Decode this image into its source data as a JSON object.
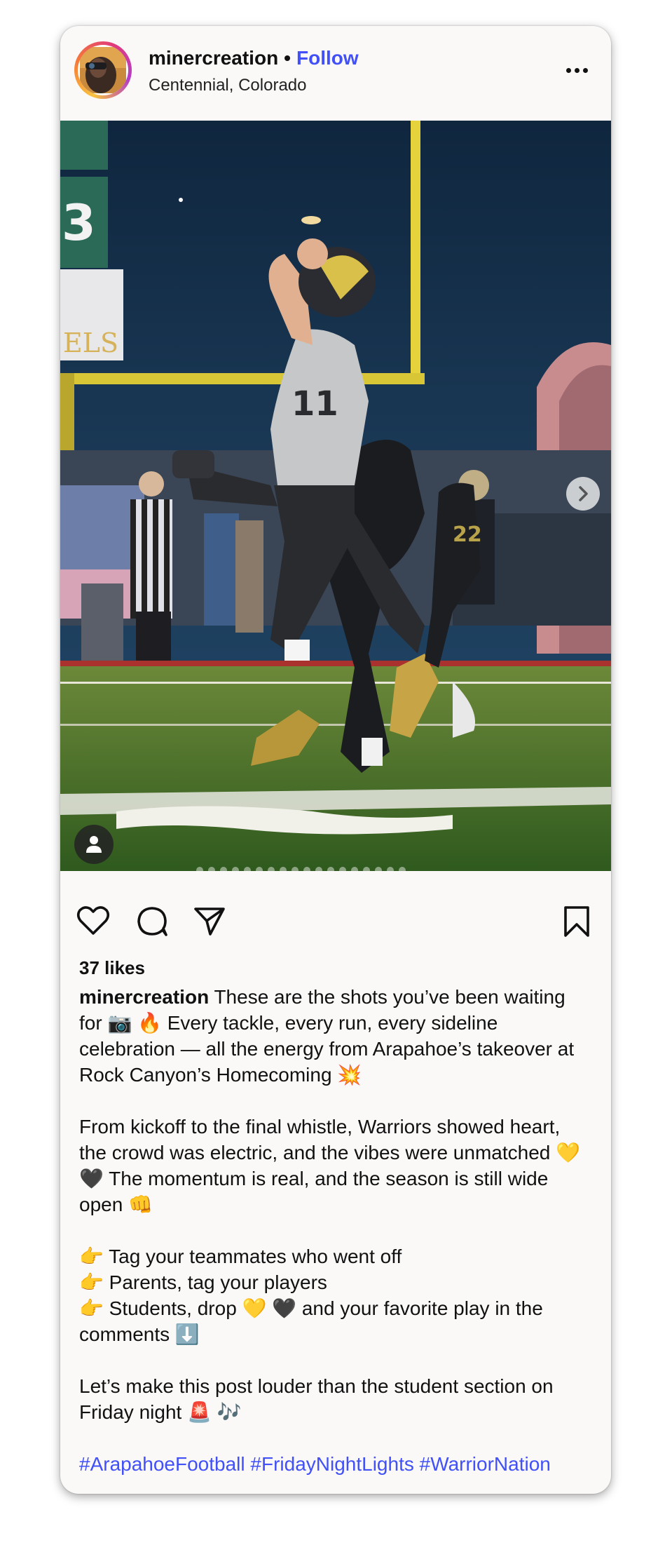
{
  "post": {
    "username": "minercreation",
    "separator": "•",
    "follow_label": "Follow",
    "location": "Centennial, Colorado",
    "more_icon": "more-horizontal-icon",
    "image_count_dots": 18,
    "likes": "37 likes",
    "caption_lines": [
      "These are the shots you’ve been waiting",
      "for 📷 🔥 Every tackle, every run, every sideline",
      "celebration — all the energy from Arapahoe’s takeover at",
      "Rock Canyon’s Homecoming 💥",
      "",
      "From kickoff to the final whistle, Warriors showed heart,",
      "the crowd was electric, and the vibes were unmatched 💛",
      "🖤 The momentum is real, and the season is still wide",
      "open 👊",
      "",
      "👉 Tag your teammates who went off",
      "👉 Parents, tag your players",
      "👉 Students, drop 💛 🖤 and your favorite play in the",
      "comments ⬇️",
      "",
      "Let’s make this post louder than the student section on",
      "Friday night 🚨 🎶",
      ""
    ],
    "hashtags": "#ArapahoeFootball #FridayNightLights #WarriorNation"
  },
  "icons": {
    "like": "heart-icon",
    "comment": "comment-icon",
    "share": "send-icon",
    "save": "bookmark-icon",
    "next": "chevron-right-icon",
    "tags": "user-tag-icon"
  },
  "colors": {
    "link_blue": "#4150f7",
    "card_bg": "#faf9f8"
  }
}
